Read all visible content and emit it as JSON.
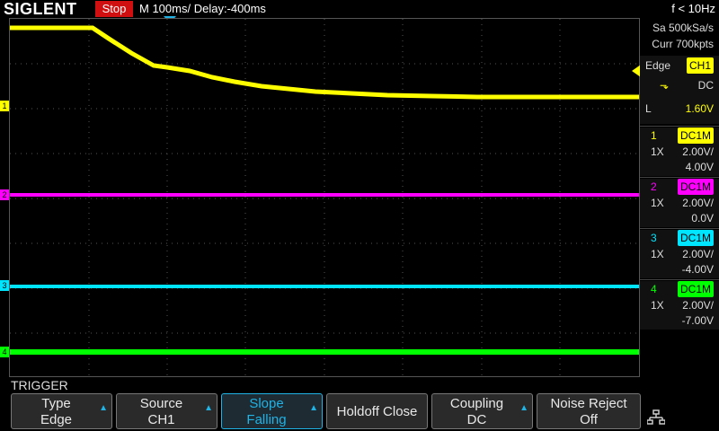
{
  "header": {
    "brand": "SIGLENT",
    "status": "Stop",
    "timebase": "M 100ms/",
    "delay": "Delay:-400ms",
    "frequency": "f < 10Hz"
  },
  "acquisition": {
    "sample_rate": "Sa 500kSa/s",
    "memory_depth": "Curr 700kpts"
  },
  "trigger_panel": {
    "type": "Edge",
    "source": "CH1",
    "slope_symbol": "⬎",
    "coupling": "DC",
    "level_prefix": "L",
    "level": "1.60V"
  },
  "channels": [
    {
      "num": "1",
      "coupling": "DC1M",
      "probe": "1X",
      "scale": "2.00V/",
      "offset": "4.00V",
      "color": "#ffff00"
    },
    {
      "num": "2",
      "coupling": "DC1M",
      "probe": "1X",
      "scale": "2.00V/",
      "offset": "0.0V",
      "color": "#ff00ff"
    },
    {
      "num": "3",
      "coupling": "DC1M",
      "probe": "1X",
      "scale": "2.00V/",
      "offset": "-4.00V",
      "color": "#00e5ff"
    },
    {
      "num": "4",
      "coupling": "DC1M",
      "probe": "1X",
      "scale": "2.00V/",
      "offset": "-7.00V",
      "color": "#00ff00"
    }
  ],
  "menu": {
    "title": "TRIGGER",
    "softkeys": [
      {
        "label": "Type",
        "value": "Edge"
      },
      {
        "label": "Source",
        "value": "CH1"
      },
      {
        "label": "Slope",
        "value": "Falling"
      },
      {
        "label": "Holdoff Close",
        "value": ""
      },
      {
        "label": "Coupling",
        "value": "DC"
      },
      {
        "label": "Noise Reject",
        "value": "Off"
      }
    ],
    "lan_icon": "network-icon"
  },
  "colors": {
    "stop_badge": "#d01010",
    "active_softkey": "#1fb3e6",
    "grid": "#555555"
  }
}
